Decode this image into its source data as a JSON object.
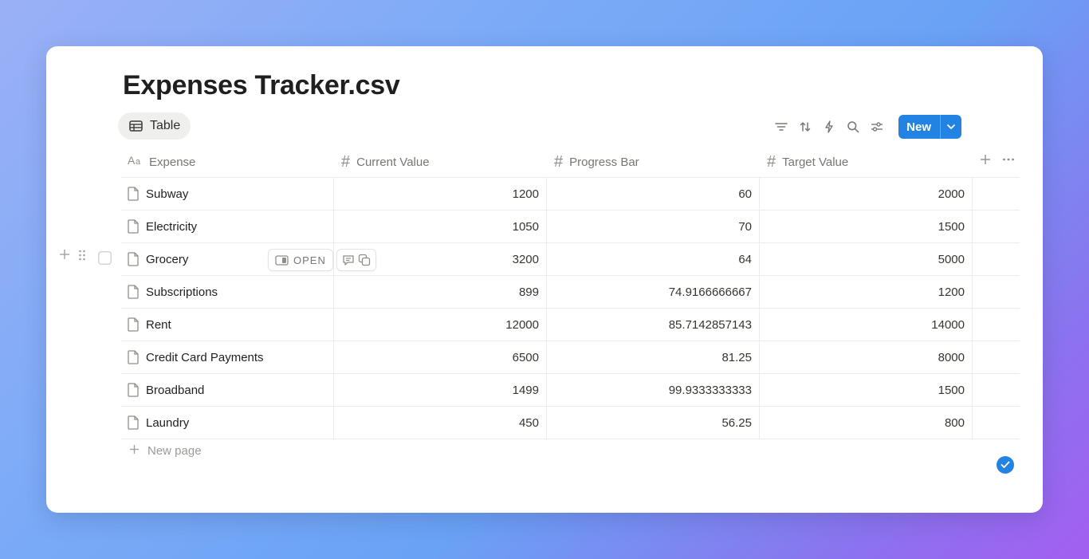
{
  "page": {
    "title": "Expenses Tracker.csv",
    "view_tab": {
      "label": "Table",
      "icon": "table-icon"
    }
  },
  "toolbar": {
    "icons": [
      "filter-icon",
      "sort-icon",
      "automation-lightning-icon",
      "search-icon",
      "settings-sliders-icon"
    ],
    "new_label": "New",
    "new_dropdown_icon": "chevron-down-icon"
  },
  "columns": [
    {
      "label": "Expense",
      "icon": "text-type-icon"
    },
    {
      "label": "Current Value",
      "icon": "number-hash-icon"
    },
    {
      "label": "Progress Bar",
      "icon": "number-hash-icon"
    },
    {
      "label": "Target Value",
      "icon": "number-hash-icon"
    }
  ],
  "rows": [
    {
      "expense": "Subway",
      "current": "1200",
      "progress": "60",
      "target": "2000"
    },
    {
      "expense": "Electricity",
      "current": "1050",
      "progress": "70",
      "target": "1500"
    },
    {
      "expense": "Grocery",
      "current": "3200",
      "progress": "64",
      "target": "5000"
    },
    {
      "expense": "Subscriptions",
      "current": "899",
      "progress": "74.9166666667",
      "target": "1200"
    },
    {
      "expense": "Rent",
      "current": "12000",
      "progress": "85.7142857143",
      "target": "14000"
    },
    {
      "expense": "Credit Card Payments",
      "current": "6500",
      "progress": "81.25",
      "target": "8000"
    },
    {
      "expense": "Broadband",
      "current": "1499",
      "progress": "99.9333333333",
      "target": "1500"
    },
    {
      "expense": "Laundry",
      "current": "450",
      "progress": "56.25",
      "target": "800"
    }
  ],
  "row_hover": {
    "row_index": 2,
    "open_label": "OPEN"
  },
  "new_page_label": "New page",
  "colors": {
    "accent": "#2383e2",
    "text": "#37352f",
    "muted": "#787774",
    "border": "#ededeb"
  }
}
